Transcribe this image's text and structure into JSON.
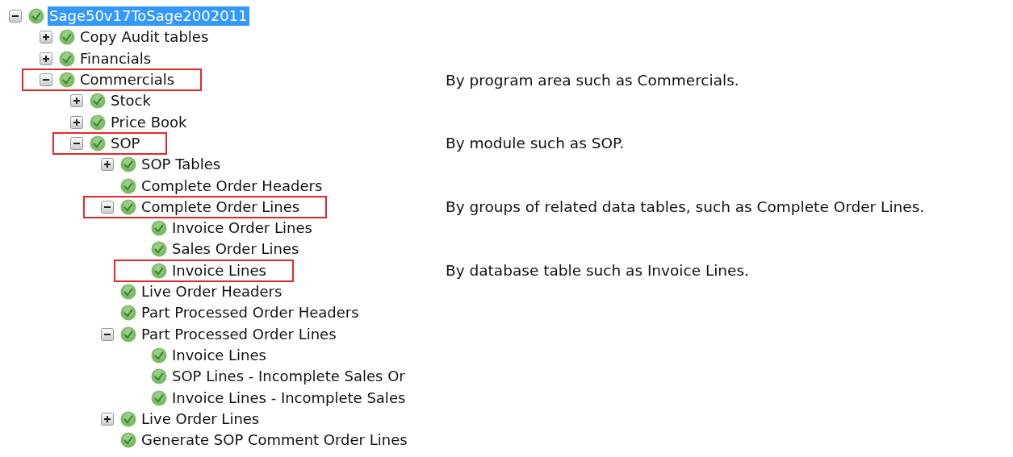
{
  "tree": [
    {
      "label": "Sage50v17ToSage2002011",
      "expanded": true,
      "selected": true,
      "highlighted": false,
      "children": [
        {
          "label": "Copy Audit tables",
          "expanded": false,
          "selected": false,
          "highlighted": false
        },
        {
          "label": "Financials",
          "expanded": false,
          "selected": false,
          "highlighted": false
        },
        {
          "label": "Commercials",
          "expanded": true,
          "selected": false,
          "highlighted": true,
          "note": "By program area such as Commercials.",
          "children": [
            {
              "label": "Stock",
              "expanded": false,
              "selected": false,
              "highlighted": false
            },
            {
              "label": "Price Book",
              "expanded": false,
              "selected": false,
              "highlighted": false
            },
            {
              "label": "SOP",
              "expanded": true,
              "selected": false,
              "highlighted": true,
              "note": "By module such as SOP.",
              "children": [
                {
                  "label": "SOP Tables",
                  "expanded": false,
                  "selected": false,
                  "highlighted": false
                },
                {
                  "label": "Complete Order Headers",
                  "selected": false,
                  "highlighted": false
                },
                {
                  "label": "Complete Order Lines",
                  "expanded": true,
                  "selected": false,
                  "highlighted": true,
                  "note": "By groups of related data tables, such as Complete Order Lines.",
                  "children": [
                    {
                      "label": "Invoice Order Lines",
                      "selected": false,
                      "highlighted": false
                    },
                    {
                      "label": "Sales Order Lines",
                      "selected": false,
                      "highlighted": false
                    },
                    {
                      "label": "Invoice Lines",
                      "selected": false,
                      "highlighted": true,
                      "note": "By database table such as Invoice Lines."
                    }
                  ]
                },
                {
                  "label": "Live Order Headers",
                  "selected": false,
                  "highlighted": false
                },
                {
                  "label": "Part Processed Order Headers",
                  "selected": false,
                  "highlighted": false
                },
                {
                  "label": "Part Processed Order Lines",
                  "expanded": true,
                  "selected": false,
                  "highlighted": false,
                  "children": [
                    {
                      "label": "Invoice Lines",
                      "selected": false,
                      "highlighted": false
                    },
                    {
                      "label": "SOP Lines - Incomplete Sales Or",
                      "selected": false,
                      "highlighted": false
                    },
                    {
                      "label": "Invoice Lines - Incomplete Sales",
                      "selected": false,
                      "highlighted": false
                    }
                  ]
                },
                {
                  "label": "Live Order Lines",
                  "expanded": false,
                  "selected": false,
                  "highlighted": false
                },
                {
                  "label": "Generate SOP Comment Order Lines",
                  "selected": false,
                  "highlighted": false
                }
              ]
            }
          ]
        }
      ]
    }
  ]
}
